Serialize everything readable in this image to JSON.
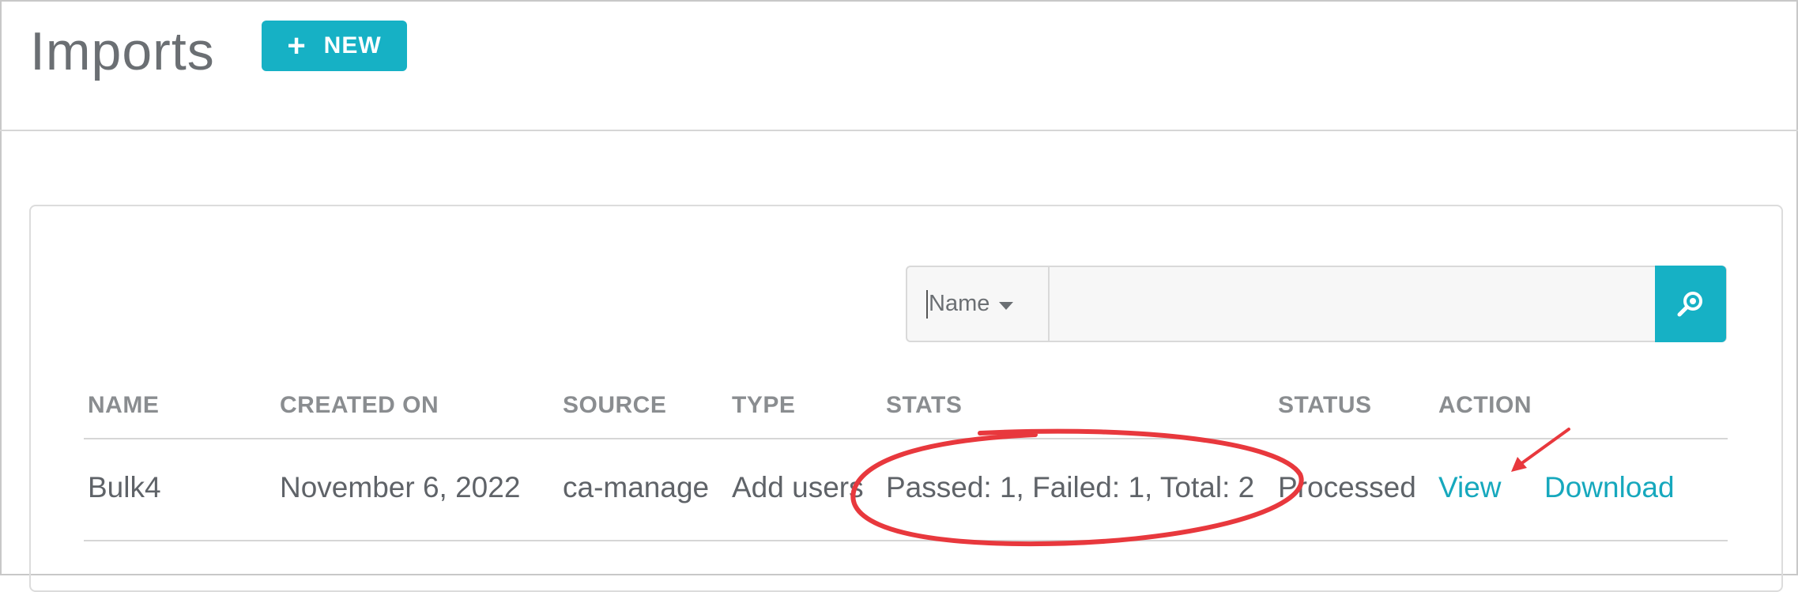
{
  "header": {
    "title": "Imports",
    "new_button_label": "NEW",
    "new_button_icon": "plus-icon"
  },
  "search": {
    "field_selector": "Name",
    "field_selector_icon": "caret-down-icon",
    "input_value": "",
    "button_icon": "search-icon"
  },
  "table": {
    "columns": [
      "NAME",
      "CREATED ON",
      "SOURCE",
      "TYPE",
      "STATS",
      "STATUS",
      "ACTION"
    ],
    "rows": [
      {
        "name": "Bulk4",
        "created_on": "November 6, 2022",
        "source": "ca-manage",
        "type": "Add users",
        "stats": "Passed: 1, Failed: 1, Total: 2",
        "status": "Processed",
        "actions": [
          "View",
          "Download"
        ]
      }
    ]
  },
  "colors": {
    "accent": "#16b1c5",
    "link": "#16a8bd",
    "annotation": "#e8383d"
  }
}
